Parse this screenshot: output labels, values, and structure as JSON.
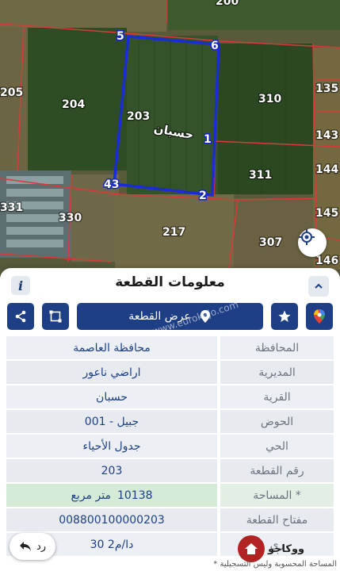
{
  "map": {
    "parcel_labels": [
      "205",
      "204",
      "203",
      "310",
      "135",
      "143",
      "311",
      "144",
      "331",
      "330",
      "217",
      "307",
      "145",
      "146",
      "200"
    ],
    "vertex_labels": [
      "1",
      "2",
      "43",
      "5",
      "6"
    ],
    "area_name": "حسبان",
    "outline_color": "#1a2cd6"
  },
  "panel": {
    "title": "معلومات القطعة",
    "show_plot_label": "عرض القطعة",
    "watermark": "www.eurokajo.com"
  },
  "rows": [
    {
      "label": "المحافظة",
      "value": "محافظة العاصمة"
    },
    {
      "label": "المديرية",
      "value": "اراضي ناعور"
    },
    {
      "label": "القرية",
      "value": "حسبان"
    },
    {
      "label": "الحوض",
      "value": "جبيل - 001"
    },
    {
      "label": "الحي",
      "value": "جدول الأحياء"
    },
    {
      "label": "رقم القطعة",
      "value": "203"
    },
    {
      "label": "المساحة *",
      "value": "متر مربع",
      "number": "10138"
    },
    {
      "label": "مفتاح القطعة",
      "value": "008800100000203"
    },
    {
      "label": "ري",
      "value": "30 دا/م2"
    }
  ],
  "bottom": {
    "back_label": "رد",
    "brand": "ووكاجو",
    "footnote": "* المساحة المحسوبة وليس التسجيلية"
  },
  "colors": {
    "primary": "#1e3f86",
    "value_text": "#1e3f86",
    "label_text": "#6c7480",
    "row_bg": "#eceff3",
    "area_bg": "#d6ead8"
  }
}
